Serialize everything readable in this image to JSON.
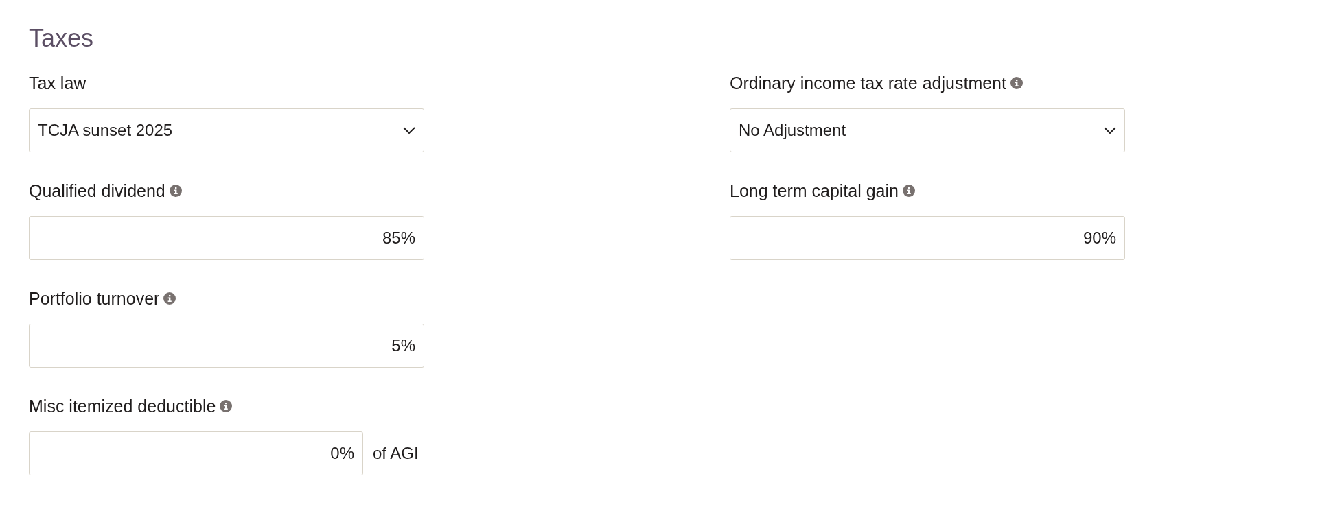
{
  "title": "Taxes",
  "columns": [
    [
      {
        "kind": "select",
        "label": "Tax law",
        "info": false,
        "value": "TCJA sunset 2025"
      },
      {
        "kind": "input",
        "label": "Qualified dividend",
        "info": true,
        "value": "85%"
      },
      {
        "kind": "input",
        "label": "Portfolio turnover",
        "info": true,
        "value": "5%"
      },
      {
        "kind": "input",
        "label": "Misc itemized deductible",
        "info": true,
        "value": "0%",
        "suffix": "of AGI"
      }
    ],
    [
      {
        "kind": "select",
        "label": "Ordinary income tax rate adjustment",
        "info": true,
        "value": "No Adjustment"
      },
      {
        "kind": "input",
        "label": "Long term capital gain",
        "info": true,
        "value": "90%"
      }
    ]
  ]
}
